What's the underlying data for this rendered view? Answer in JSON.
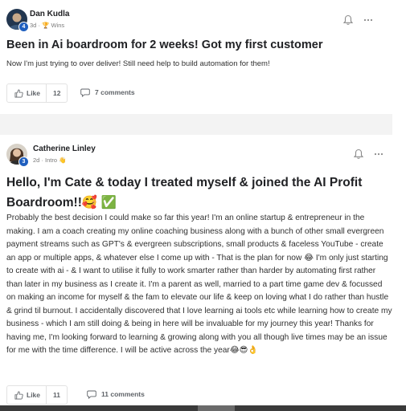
{
  "posts": [
    {
      "author": "Dan Kudla",
      "level": "4",
      "time": "3d",
      "category_icon": "trophy-icon",
      "category": "Wins",
      "title": "Been in Ai boardroom for 2 weeks! Got my first customer",
      "body": "Now I'm just trying to over deliver! Still need help to build automation for them!",
      "like_label": "Like",
      "like_count": "12",
      "comments_label": "7 comments"
    },
    {
      "author": "Catherine Linley",
      "level": "3",
      "time": "2d",
      "category": "Intro 👋",
      "title": "Hello, I'm Cate & today I treated myself & joined the AI Profit Boardroom!!🥰 ✅",
      "body": "Probably the best decision I could make so far this year! I'm an online startup & entrepreneur in the making. I am a coach creating my online coaching business along with a bunch of other small evergreen payment streams such as GPT's & evergreen subscriptions, small products & faceless YouTube - create an app or multiple apps, & whatever else I come up with - That is the plan for now 😂 I'm only just starting to create with ai - & I want to utilise it fully to work smarter rather than harder by automating first rather than later in my business as I create it. I'm a parent as well, married to a part time game dev & focussed on making an income for myself & the fam to elevate our life & keep on loving what I do rather than hustle & grind til burnout. I accidentally discovered that I love learning ai tools etc while learning how to create my business - which I am still doing & being in here will be invaluable for my journey this year! Thanks for having me, I'm looking forward to learning & growing along with you all though live times may be an issue for me with the time difference. I will be active across the year😂😎👌",
      "like_label": "Like",
      "like_count": "11",
      "comments_label": "11 comments"
    }
  ],
  "meta_separator": "·",
  "icons": {
    "bell": "bell-icon",
    "more": "more-icon",
    "like": "thumbs-up-icon",
    "comment": "comment-icon"
  },
  "colors": {
    "level_badge": "#1f5fbf",
    "text": "#202124",
    "muted": "#7a7a7a",
    "trophy": "#c79a1a"
  }
}
